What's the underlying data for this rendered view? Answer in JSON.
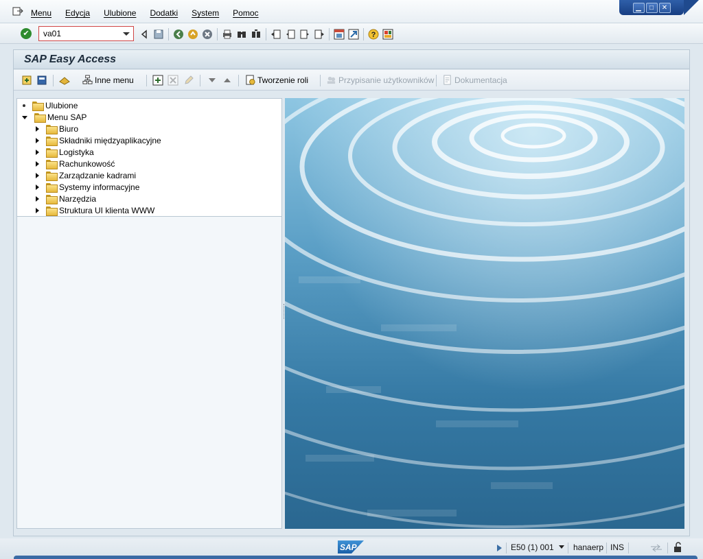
{
  "menubar": {
    "items": [
      "Menu",
      "Edycja",
      "Ulubione",
      "Dodatki",
      "System",
      "Pomoc"
    ],
    "window_controls": [
      "minimize-icon",
      "maximize-icon",
      "close-icon"
    ]
  },
  "toolbar": {
    "command_field_value": "va01",
    "icons": [
      "enter-icon",
      "back-arrow-icon",
      "save-icon",
      "back-icon",
      "exit-icon",
      "cancel-icon",
      "print-icon",
      "find-icon",
      "find-next-icon",
      "first-page-icon",
      "previous-page-icon",
      "next-page-icon",
      "last-page-icon",
      "create-session-icon",
      "shortcut-icon",
      "help-icon",
      "layout-icon"
    ]
  },
  "easy_access": {
    "title": "SAP Easy Access",
    "toolbar": {
      "other_menu": "Inne menu",
      "create_role": "Tworzenie roli",
      "assign_users": "Przypisanie użytkowników",
      "documentation": "Dokumentacja"
    },
    "tree": {
      "favorites": "Ulubione",
      "sap_menu": "Menu SAP",
      "items": [
        "Biuro",
        "Składniki międzyaplikacyjne",
        "Logistyka",
        "Rachunkowość",
        "Zarządzanie kadrami",
        "Systemy informacyjne",
        "Narzędzia",
        "Struktura UI klienta WWW"
      ]
    }
  },
  "statusbar": {
    "system": "E50 (1) 001",
    "server": "hanaerp",
    "mode": "INS",
    "logo": "SAP"
  },
  "colors": {
    "accent_blue": "#1f4a8e",
    "background": "#dfe8ef",
    "folder": "#f2cd55"
  }
}
